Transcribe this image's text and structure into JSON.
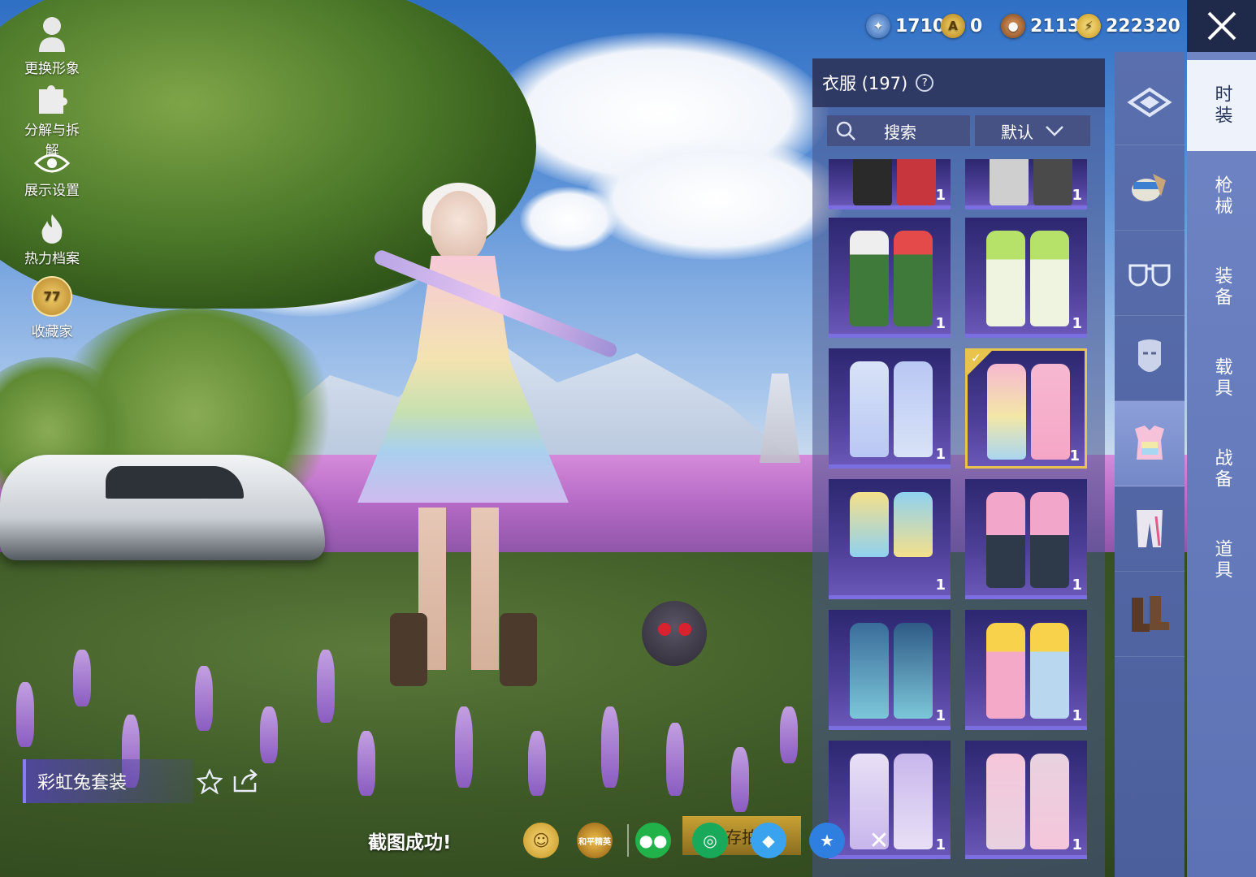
{
  "left_toolbar": {
    "change_look": "更换形象",
    "decompose": "分解与拆解",
    "display_settings": "展示设置",
    "heat_archive": "热力档案",
    "collector": "收藏家",
    "collector_level": "77"
  },
  "currencies": [
    {
      "icon": "trophy-coin-icon",
      "value": "1710",
      "color": "#3b7bd1"
    },
    {
      "icon": "gold-a-coin-icon",
      "value": "0",
      "color": "#d9a520"
    },
    {
      "icon": "bronze-coin-icon",
      "value": "2113",
      "color": "#b36b2e"
    },
    {
      "icon": "lightning-coin-icon",
      "value": "222320",
      "color": "#e2b625"
    }
  ],
  "panel": {
    "title": "衣服 (197)",
    "help": "?",
    "search_label": "搜索",
    "sort_label": "默认"
  },
  "categories": [
    {
      "label": "时装",
      "active": true
    },
    {
      "label": "枪械",
      "active": false
    },
    {
      "label": "装备",
      "active": false
    },
    {
      "label": "载具",
      "active": false
    },
    {
      "label": "战备",
      "active": false
    },
    {
      "label": "道具",
      "active": false
    }
  ],
  "sub_tabs": [
    {
      "icon": "wardrobe-icon"
    },
    {
      "icon": "hat-icon"
    },
    {
      "icon": "glasses-icon"
    },
    {
      "icon": "mask-icon"
    },
    {
      "icon": "outfit-icon"
    },
    {
      "icon": "pants-icon"
    },
    {
      "icon": "boots-icon"
    }
  ],
  "items": [
    {
      "qty": "1",
      "colors": [
        "#c7353d",
        "#eee"
      ]
    },
    {
      "qty": "1",
      "colors": [
        "#cfcfcf",
        "#4a4a4a"
      ]
    },
    {
      "qty": "1",
      "colors": [
        "#3f7a3a",
        "#e44a4a"
      ]
    },
    {
      "qty": "1",
      "colors": [
        "#b7e26a",
        "#eef4e0"
      ]
    },
    {
      "qty": "1",
      "colors": [
        "#b9c7f4",
        "#d8e3f7"
      ]
    },
    {
      "qty": "1",
      "colors": [
        "#f6b8d0",
        "#f3e7a8"
      ],
      "selected": true
    },
    {
      "qty": "1",
      "colors": [
        "#f5e08a",
        "#8fd1f0"
      ]
    },
    {
      "qty": "1",
      "colors": [
        "#f2a6c9",
        "#2e3a4a"
      ]
    },
    {
      "qty": "1",
      "colors": [
        "#3a6c9a",
        "#7cc7d9"
      ]
    },
    {
      "qty": "1",
      "colors": [
        "#f7d24a",
        "#f5a9c8"
      ]
    },
    {
      "qty": "1",
      "colors": [
        "#c8b6ec",
        "#e8e0f6"
      ]
    },
    {
      "qty": "1",
      "colors": [
        "#f5c6da",
        "#e8d2e0"
      ]
    }
  ],
  "outfit_name": "彩虹兔套装",
  "share": {
    "toast": "截图成功!",
    "app_badge": "和平精英",
    "save_label": "存拍"
  }
}
